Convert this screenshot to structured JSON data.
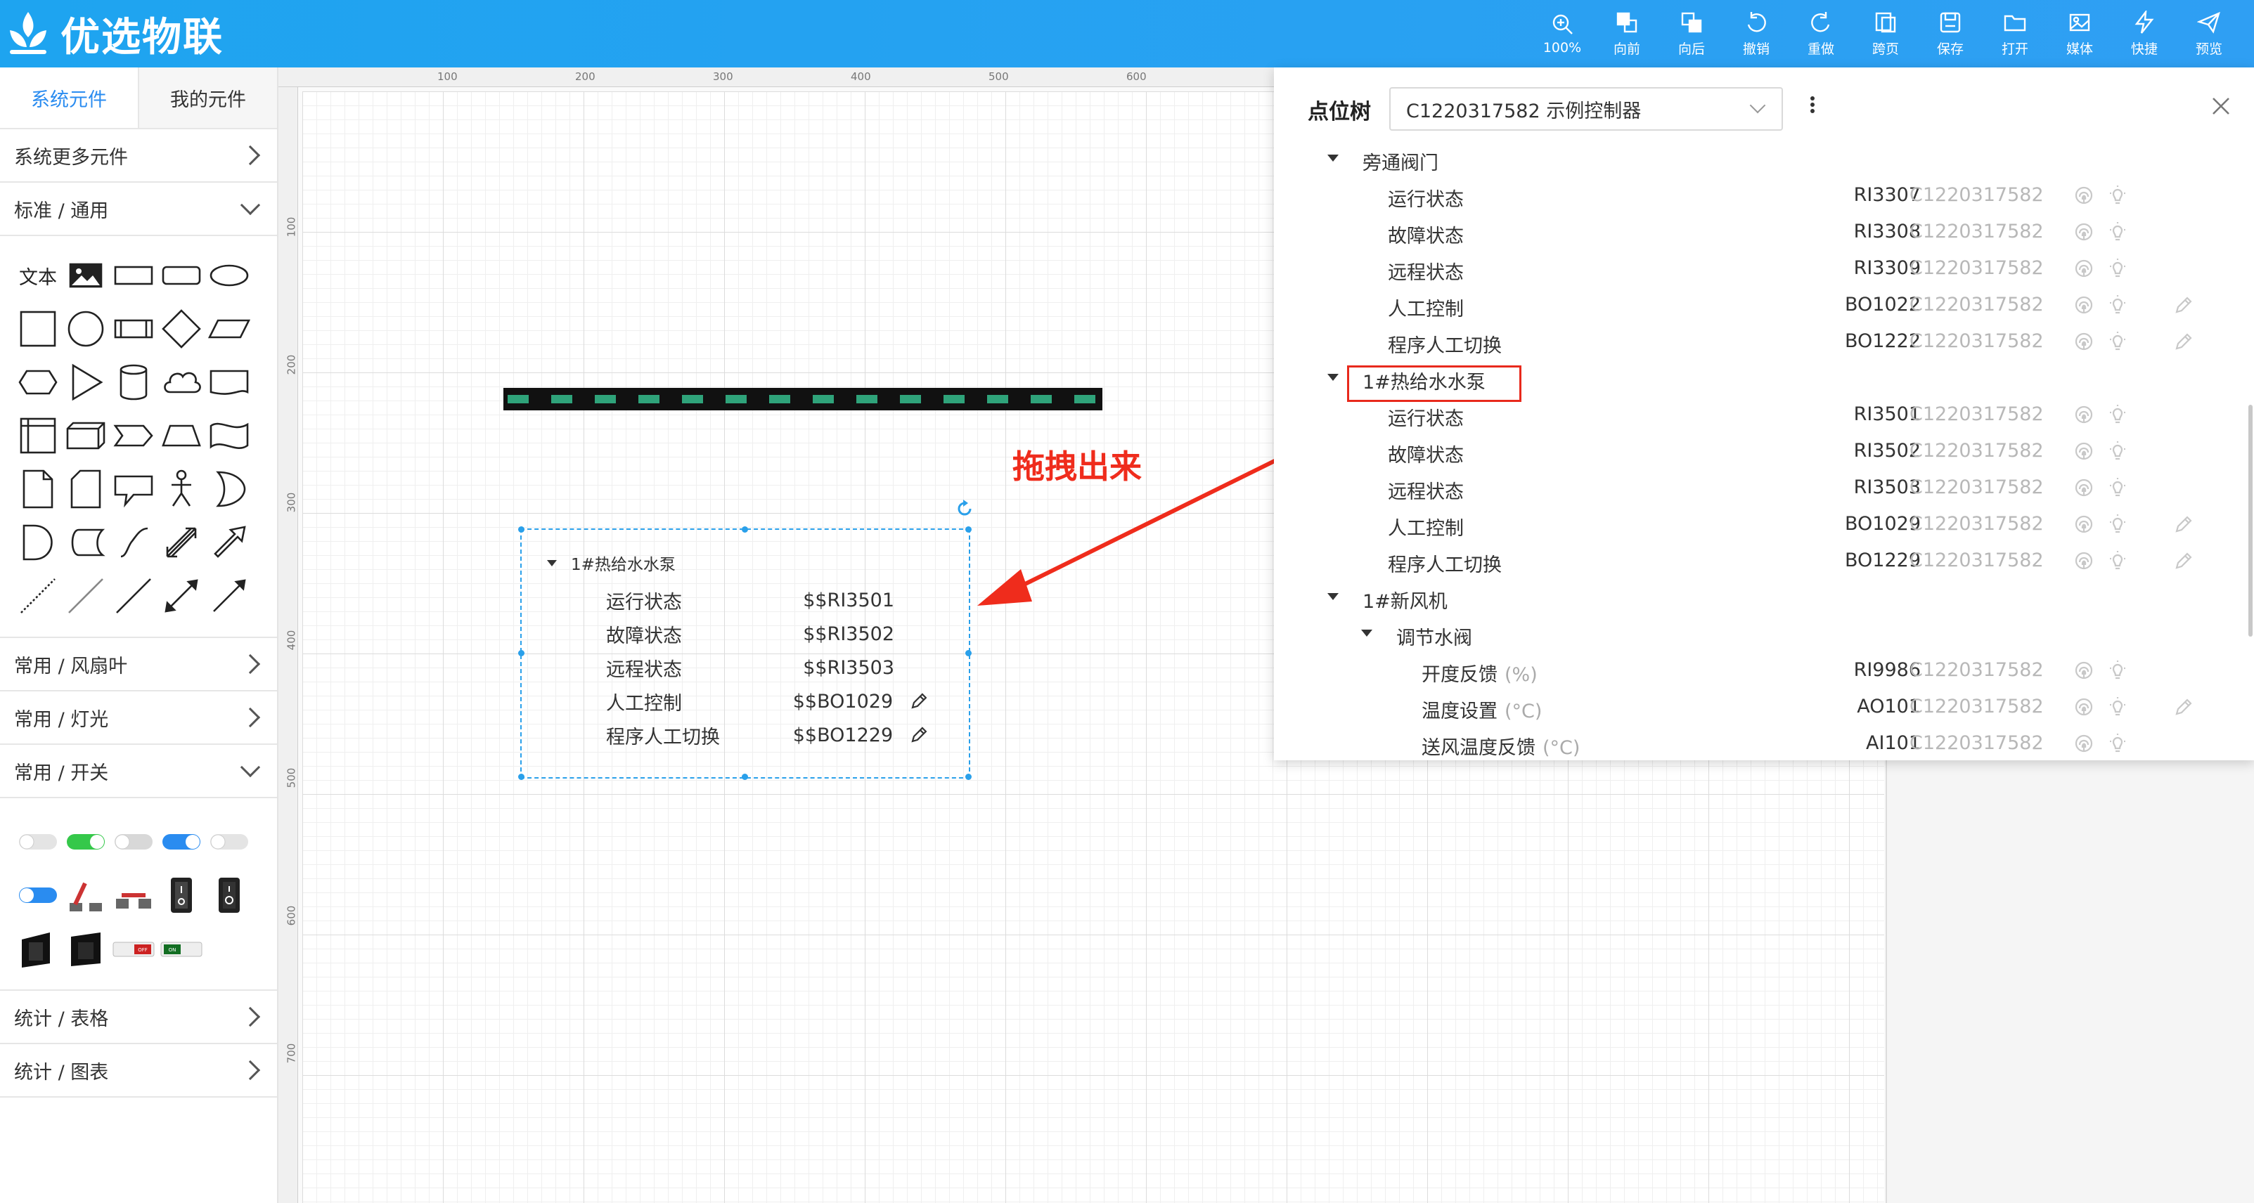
{
  "app": {
    "title": "优选物联"
  },
  "toolbar": [
    {
      "icon": "zoom-icon",
      "label": "100%"
    },
    {
      "icon": "bring-forward-icon",
      "label": "向前"
    },
    {
      "icon": "send-backward-icon",
      "label": "向后"
    },
    {
      "icon": "undo-icon",
      "label": "撤销"
    },
    {
      "icon": "redo-icon",
      "label": "重做"
    },
    {
      "icon": "cross-page-icon",
      "label": "跨页"
    },
    {
      "icon": "save-icon",
      "label": "保存"
    },
    {
      "icon": "open-folder-icon",
      "label": "打开"
    },
    {
      "icon": "media-icon",
      "label": "媒体"
    },
    {
      "icon": "lightning-icon",
      "label": "快捷"
    },
    {
      "icon": "send-icon",
      "label": "预览"
    }
  ],
  "left": {
    "tabs": {
      "system": "系统元件",
      "mine": "我的元件"
    },
    "categories": {
      "more": "系统更多元件",
      "standard": "标准 / 通用",
      "fan": "常用 / 风扇叶",
      "light": "常用 / 灯光",
      "switch": "常用 / 开关",
      "table": "统计 / 表格",
      "chart": "统计 / 图表"
    },
    "text_shape_label": "文本"
  },
  "ruler": {
    "top": [
      "100",
      "200",
      "300",
      "400",
      "500",
      "600"
    ],
    "left": [
      "100",
      "200",
      "300",
      "400",
      "500",
      "600",
      "700"
    ]
  },
  "widget": {
    "group": "1#热给水水泵",
    "rows": [
      {
        "label": "运行状态",
        "value": "$$RI3501",
        "editable": false
      },
      {
        "label": "故障状态",
        "value": "$$RI3502",
        "editable": false
      },
      {
        "label": "远程状态",
        "value": "$$RI3503",
        "editable": false
      },
      {
        "label": "人工控制",
        "value": "$$BO1029",
        "editable": true
      },
      {
        "label": "程序人工切换",
        "value": "$$BO1229",
        "editable": true
      }
    ]
  },
  "annotation": "拖拽出来",
  "point_tree": {
    "title": "点位树",
    "controller": "C1220317582 示例控制器",
    "rows": [
      {
        "type": "group",
        "name": "旁通阀门",
        "indent": 0
      },
      {
        "type": "point",
        "name": "运行状态",
        "code": "RI3307",
        "dev": "C1220317582",
        "edit": false,
        "indent": 1
      },
      {
        "type": "point",
        "name": "故障状态",
        "code": "RI3308",
        "dev": "C1220317582",
        "edit": false,
        "indent": 1
      },
      {
        "type": "point",
        "name": "远程状态",
        "code": "RI3309",
        "dev": "C1220317582",
        "edit": false,
        "indent": 1
      },
      {
        "type": "point",
        "name": "人工控制",
        "code": "BO1022",
        "dev": "C1220317582",
        "edit": true,
        "indent": 1
      },
      {
        "type": "point",
        "name": "程序人工切换",
        "code": "BO1222",
        "dev": "C1220317582",
        "edit": true,
        "indent": 1
      },
      {
        "type": "group",
        "name": "1#热给水水泵",
        "indent": 0
      },
      {
        "type": "point",
        "name": "运行状态",
        "code": "RI3501",
        "dev": "C1220317582",
        "edit": false,
        "indent": 1
      },
      {
        "type": "point",
        "name": "故障状态",
        "code": "RI3502",
        "dev": "C1220317582",
        "edit": false,
        "indent": 1
      },
      {
        "type": "point",
        "name": "远程状态",
        "code": "RI3503",
        "dev": "C1220317582",
        "edit": false,
        "indent": 1
      },
      {
        "type": "point",
        "name": "人工控制",
        "code": "BO1029",
        "dev": "C1220317582",
        "edit": true,
        "indent": 1
      },
      {
        "type": "point",
        "name": "程序人工切换",
        "code": "BO1229",
        "dev": "C1220317582",
        "edit": true,
        "indent": 1
      },
      {
        "type": "group",
        "name": "1#新风机",
        "indent": 0
      },
      {
        "type": "group",
        "name": "调节水阀",
        "indent": 1
      },
      {
        "type": "point",
        "name": "开度反馈",
        "unit": "(%)",
        "code": "RI9986",
        "dev": "C1220317582",
        "edit": false,
        "indent": 2
      },
      {
        "type": "point",
        "name": "温度设置",
        "unit": "(°C)",
        "code": "AO101",
        "dev": "C1220317582",
        "edit": true,
        "indent": 2
      },
      {
        "type": "point",
        "name": "送风温度反馈",
        "unit": "(°C)",
        "code": "AI101",
        "dev": "C1220317582",
        "edit": false,
        "indent": 2
      }
    ]
  },
  "colors": {
    "brand": "#1ea4f0",
    "accent": "#2a8cf0",
    "highlight": "#e8291c",
    "pipe_dash": "#2fa37a"
  }
}
